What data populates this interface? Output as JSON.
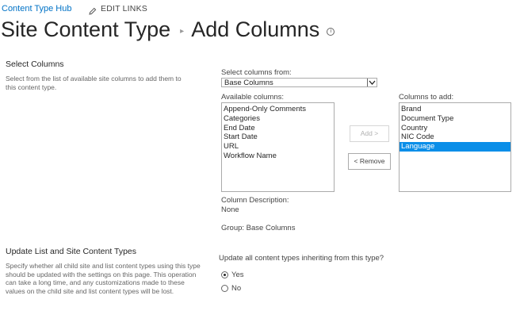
{
  "nav": {
    "hub_link": "Content Type Hub",
    "edit_links": "EDIT LINKS"
  },
  "header": {
    "crumb1": "Site Content Type",
    "crumb_sep": "▸",
    "crumb2": "Add Columns",
    "info_glyph": "i"
  },
  "select_section": {
    "heading": "Select Columns",
    "description": "Select from the list of available site columns to add them to this content type."
  },
  "picker": {
    "from_label": "Select columns from:",
    "from_value": "Base Columns",
    "available_label": "Available columns:",
    "available": [
      "Append-Only Comments",
      "Categories",
      "End Date",
      "Start Date",
      "URL",
      "Workflow Name"
    ],
    "add_button": "Add >",
    "remove_button": "< Remove",
    "to_add_label": "Columns to add:",
    "to_add": [
      "Brand",
      "Document Type",
      "Country",
      "NIC Code",
      "Language"
    ],
    "selected_index": 4,
    "column_description_label": "Column Description:",
    "column_description_value": "None",
    "group_text": "Group: Base Columns"
  },
  "update_section": {
    "heading": "Update List and Site Content Types",
    "description": "Specify whether all child site and list content types using this type should be updated with the settings on this page. This operation can take a long time, and any customizations made to these values on the child site and list content types will be lost.",
    "question": "Update all content types inheriting from this type?",
    "yes_label": "Yes",
    "no_label": "No"
  },
  "colors": {
    "link": "#0072c6",
    "selection": "#0a8ee8"
  }
}
